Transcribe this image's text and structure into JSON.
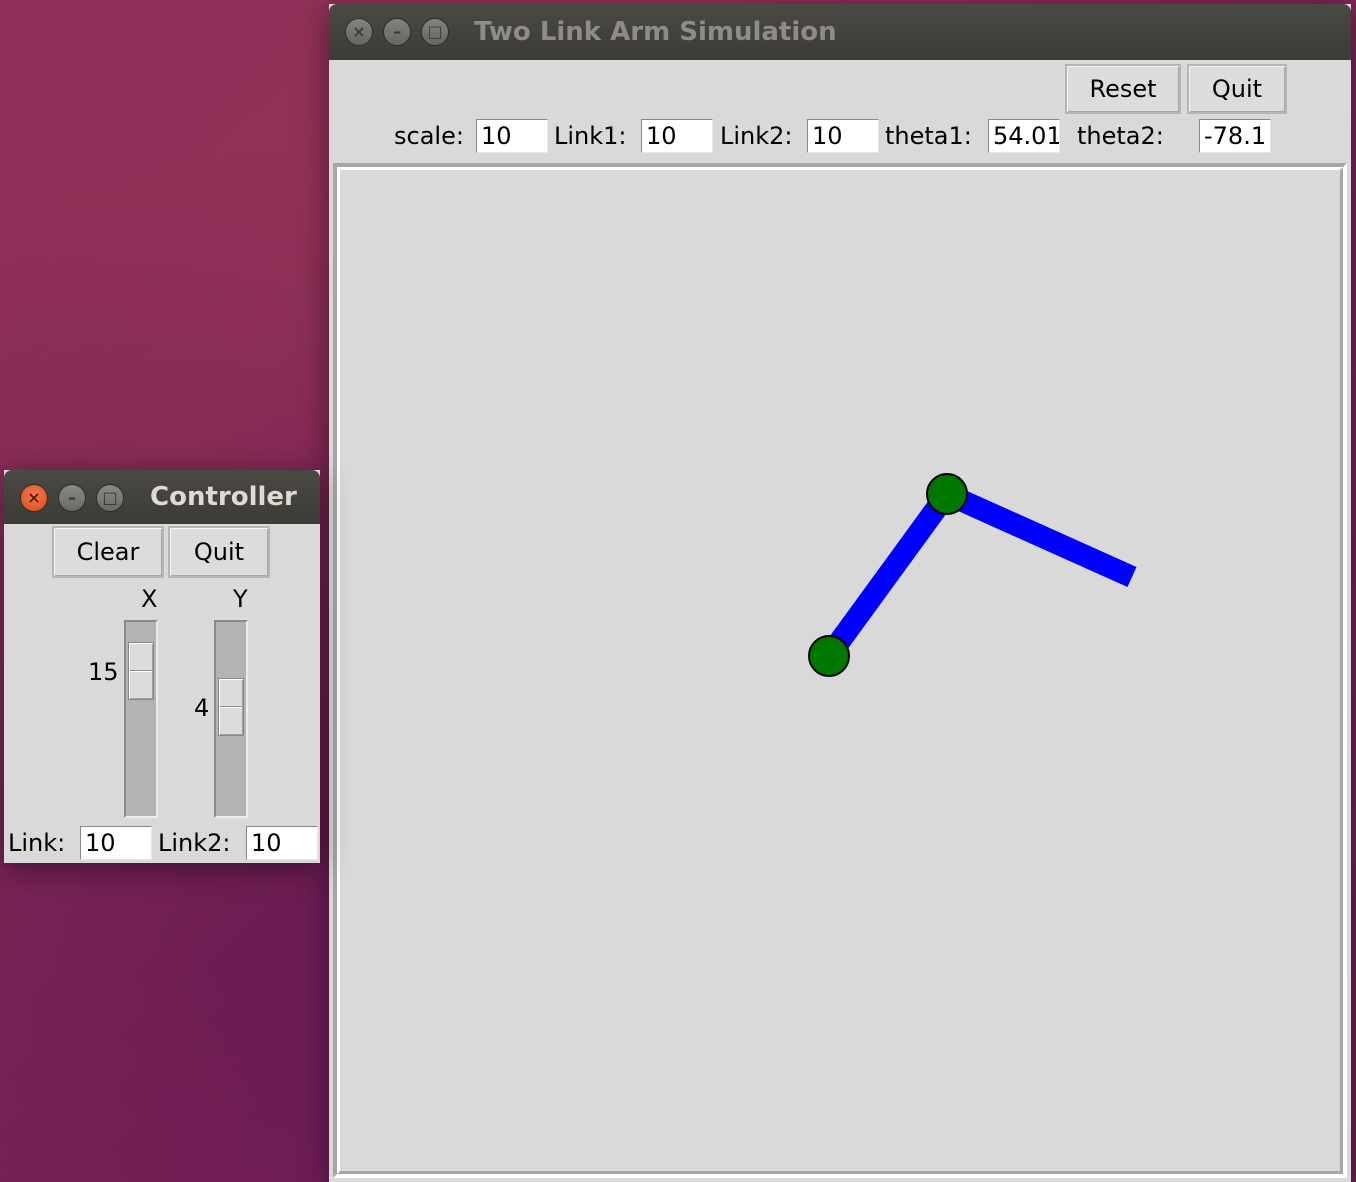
{
  "main_window": {
    "title": "Two Link Arm Simulation",
    "buttons": {
      "reset": "Reset",
      "quit": "Quit"
    },
    "fields": {
      "scale_label": "scale:",
      "scale_value": "10",
      "link1_label": "Link1:",
      "link1_value": "10",
      "link2_label": "Link2:",
      "link2_value": "10",
      "theta1_label": "theta1:",
      "theta1_value": "54.01",
      "theta2_label": "theta2:",
      "theta2_value": "-78.1"
    },
    "arm": {
      "link_color": "#0000ff",
      "joint_color": "#007800",
      "outline_color": "#000000"
    }
  },
  "controller_window": {
    "title": "Controller",
    "buttons": {
      "clear": "Clear",
      "quit": "Quit"
    },
    "sliders": {
      "x_label": "X",
      "x_value": "15",
      "y_label": "Y",
      "y_value": "4"
    },
    "fields": {
      "link_label": "Link:",
      "link_value": "10",
      "link2_label": "Link2:",
      "link2_value": "10"
    }
  },
  "colors": {
    "window_bg": "#d9d9d9",
    "titlebar_bg": "#3c3b37",
    "close_active": "#dd4814",
    "desktop_bg": "#8a2a5a"
  }
}
